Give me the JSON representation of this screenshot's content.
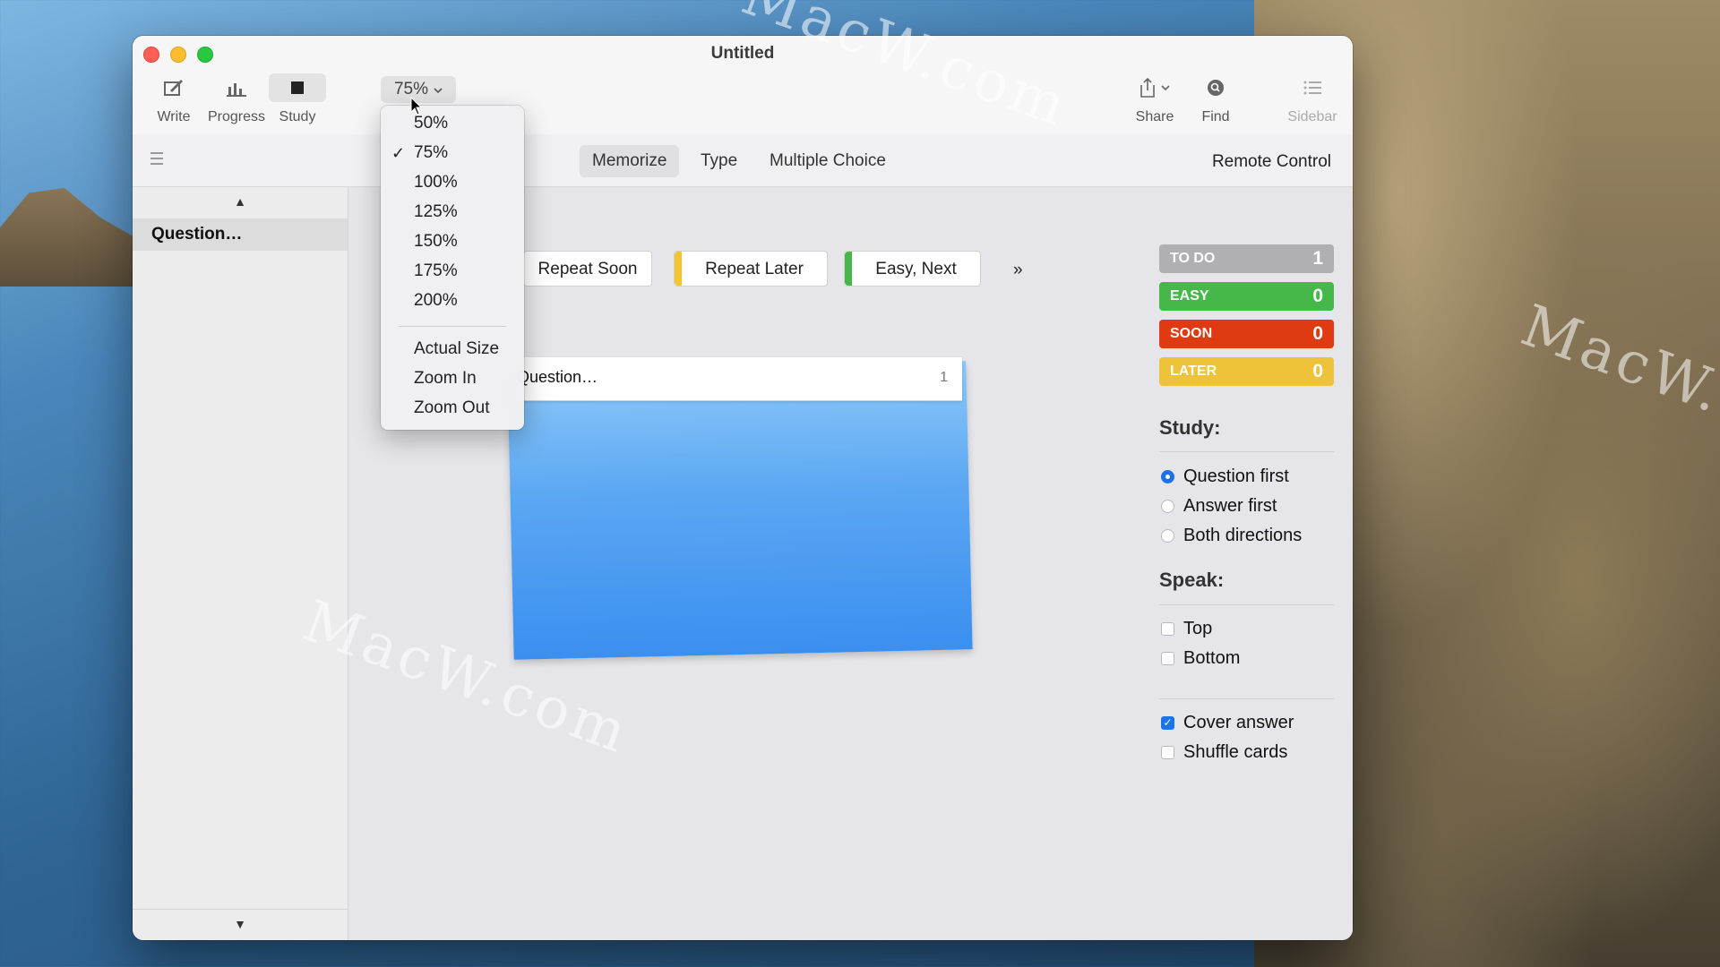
{
  "window": {
    "title": "Untitled"
  },
  "toolbar": {
    "write_label": "Write",
    "progress_label": "Progress",
    "study_label": "Study",
    "zoom_value": "75%",
    "share_label": "Share",
    "find_label": "Find",
    "sidebar_label": "Sidebar"
  },
  "modes": {
    "tabs": [
      {
        "label": "Memorize",
        "active": true
      },
      {
        "label": "Type"
      },
      {
        "label": "Multiple Choice"
      }
    ],
    "remote_control": "Remote Control"
  },
  "sidebar": {
    "items": [
      "Question…"
    ]
  },
  "answers": {
    "repeat_soon": "Repeat Soon",
    "repeat_later": "Repeat Later",
    "easy_next": "Easy, Next",
    "more": "»"
  },
  "card": {
    "question": "Question…",
    "number": "1"
  },
  "stats": [
    {
      "label": "TO DO",
      "value": "1",
      "color": "#b0b0b3"
    },
    {
      "label": "EASY",
      "value": "0",
      "color": "#46b84a"
    },
    {
      "label": "SOON",
      "value": "0",
      "color": "#e03a12"
    },
    {
      "label": "LATER",
      "value": "0",
      "color": "#eec23a"
    }
  ],
  "study": {
    "title": "Study:",
    "options": [
      {
        "label": "Question first",
        "selected": true
      },
      {
        "label": "Answer first",
        "selected": false
      },
      {
        "label": "Both directions",
        "selected": false
      }
    ]
  },
  "speak": {
    "title": "Speak:",
    "options": [
      {
        "label": "Top",
        "checked": false
      },
      {
        "label": "Bottom",
        "checked": false
      }
    ]
  },
  "extras": [
    {
      "label": "Cover answer",
      "checked": true
    },
    {
      "label": "Shuffle cards",
      "checked": false
    }
  ],
  "zoom_menu": {
    "items": [
      "50%",
      "75%",
      "100%",
      "125%",
      "150%",
      "175%",
      "200%"
    ],
    "selected": "75%",
    "actions": [
      "Actual Size",
      "Zoom In",
      "Zoom Out"
    ]
  },
  "desktop": {
    "watermark": "MacW.com"
  }
}
